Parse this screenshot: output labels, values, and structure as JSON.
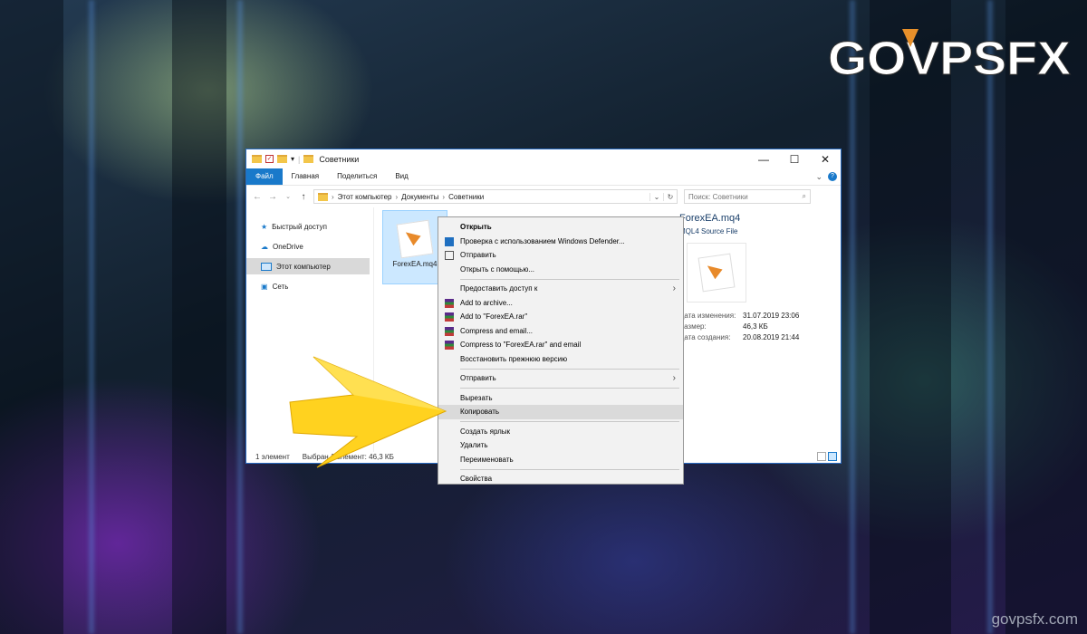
{
  "brand": {
    "logo_text": "GOVPSFX",
    "watermark": "govpsfx.com"
  },
  "window": {
    "title": "Советники",
    "controls": {
      "minimize": "—",
      "maximize": "☐",
      "close": "✕"
    },
    "ribbon_tabs": [
      "Файл",
      "Главная",
      "Поделиться",
      "Вид"
    ],
    "address": {
      "parts": [
        "Этот компьютер",
        "Документы",
        "Советники"
      ],
      "search_placeholder": "Поиск: Советники"
    },
    "nav": [
      {
        "label": "Быстрый доступ",
        "icon": "star-icon"
      },
      {
        "label": "OneDrive",
        "icon": "cloud-icon"
      },
      {
        "label": "Этот компьютер",
        "icon": "computer-icon",
        "selected": true
      },
      {
        "label": "Сеть",
        "icon": "network-icon"
      }
    ],
    "file": {
      "name": "ForexEA.mq4",
      "icon": "mq4-file-icon"
    },
    "preview": {
      "title": "ForexEA.mq4",
      "type": "MQL4 Source File",
      "props": [
        {
          "label": "Дата изменения:",
          "value": "31.07.2019 23:06"
        },
        {
          "label": "Размер:",
          "value": "46,3 КБ"
        },
        {
          "label": "Дата создания:",
          "value": "20.08.2019 21:44"
        }
      ]
    },
    "status": {
      "count": "1 элемент",
      "selected": "Выбран 1 элемент: 46,3 КБ"
    }
  },
  "context_menu": {
    "items": [
      {
        "label": "Открыть",
        "bold": true
      },
      {
        "label": "Проверка с использованием Windows Defender...",
        "icon": "defender-icon"
      },
      {
        "label": "Отправить",
        "icon": "share-icon"
      },
      {
        "label": "Открыть с помощью..."
      },
      {
        "sep": true
      },
      {
        "label": "Предоставить доступ к",
        "submenu": true
      },
      {
        "label": "Add to archive...",
        "icon": "winrar-icon"
      },
      {
        "label": "Add to \"ForexEA.rar\"",
        "icon": "winrar-icon"
      },
      {
        "label": "Compress and email...",
        "icon": "winrar-icon"
      },
      {
        "label": "Compress to \"ForexEA.rar\" and email",
        "icon": "winrar-icon"
      },
      {
        "label": "Восстановить прежнюю версию"
      },
      {
        "sep": true
      },
      {
        "label": "Отправить",
        "submenu": true
      },
      {
        "sep": true
      },
      {
        "label": "Вырезать"
      },
      {
        "label": "Копировать",
        "highlighted": true
      },
      {
        "sep": true
      },
      {
        "label": "Создать ярлык"
      },
      {
        "label": "Удалить"
      },
      {
        "label": "Переименовать"
      },
      {
        "sep": true
      },
      {
        "label": "Свойства"
      }
    ]
  },
  "colors": {
    "accent": "#1979ca",
    "arrow": "#ffd21f",
    "logo": "#ffffff",
    "logo_v": "#e8902a"
  }
}
